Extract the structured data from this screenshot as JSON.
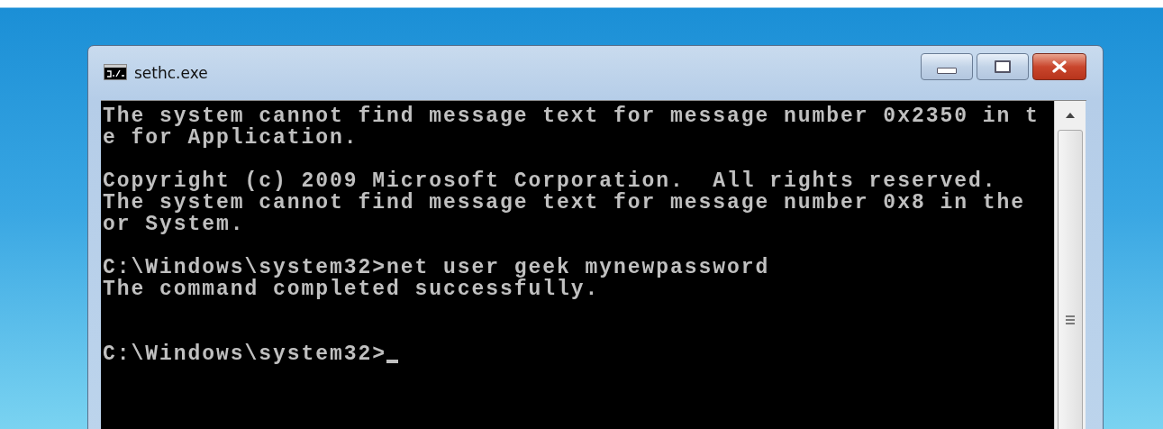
{
  "window": {
    "title": "sethc.exe"
  },
  "console": {
    "lines": [
      {
        "kind": "text",
        "text": "The system cannot find message text for message number 0x2350 in t"
      },
      {
        "kind": "text",
        "text": "e for Application."
      },
      {
        "kind": "blank"
      },
      {
        "kind": "text",
        "text": "Copyright (c) 2009 Microsoft Corporation.  All rights reserved."
      },
      {
        "kind": "text",
        "text": "The system cannot find message text for message number 0x8 in the"
      },
      {
        "kind": "text",
        "text": "or System."
      },
      {
        "kind": "blank"
      },
      {
        "kind": "text",
        "text": "C:\\Windows\\system32>net user geek mynewpassword"
      },
      {
        "kind": "text",
        "text": "The command completed successfully."
      },
      {
        "kind": "blank"
      },
      {
        "kind": "blank"
      },
      {
        "kind": "prompt",
        "text": "C:\\Windows\\system32>"
      }
    ],
    "cursor_visible": true
  }
}
